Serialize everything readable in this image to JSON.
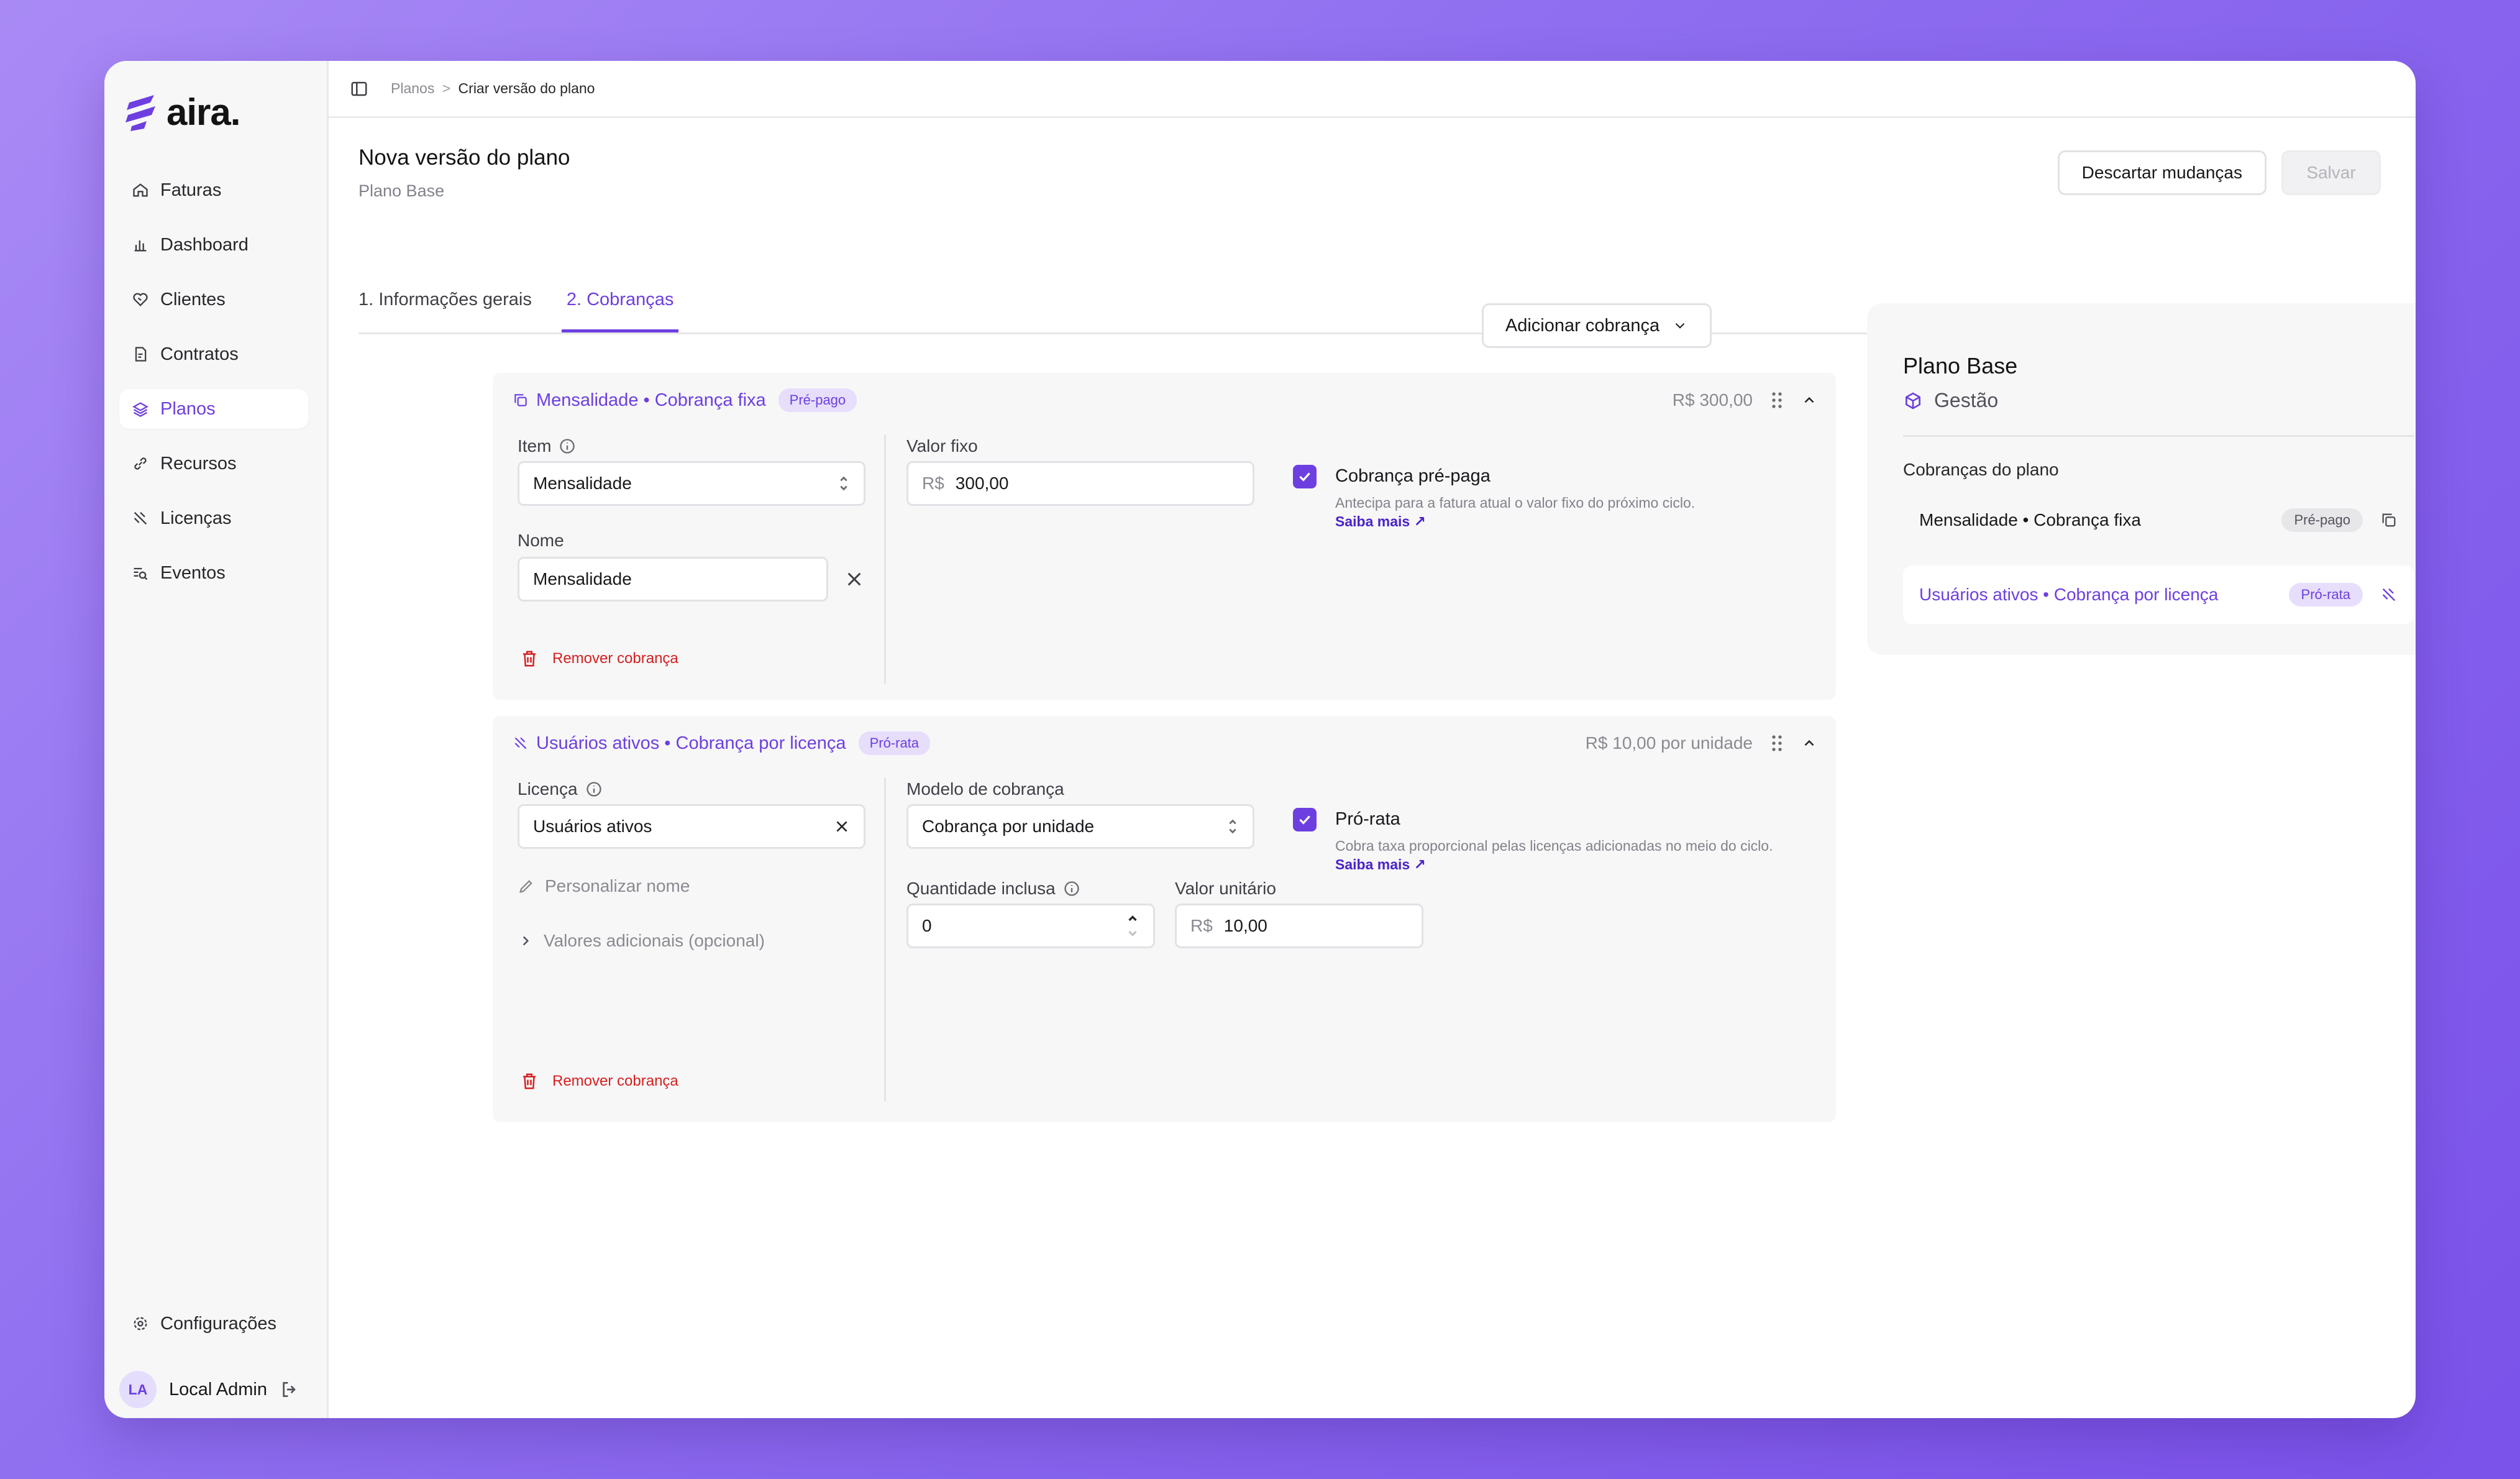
{
  "brand": {
    "name": "aira."
  },
  "sidebar": {
    "items": [
      {
        "label": "Faturas",
        "icon": "home-icon"
      },
      {
        "label": "Dashboard",
        "icon": "bar-chart-icon"
      },
      {
        "label": "Clientes",
        "icon": "handshake-icon"
      },
      {
        "label": "Contratos",
        "icon": "contract-icon"
      },
      {
        "label": "Planos",
        "icon": "layers-icon",
        "active": true
      },
      {
        "label": "Recursos",
        "icon": "link-icon"
      },
      {
        "label": "Licenças",
        "icon": "license-icon"
      },
      {
        "label": "Eventos",
        "icon": "search-list-icon"
      }
    ],
    "settings_label": "Configurações",
    "user": {
      "initials": "LA",
      "name": "Local Admin"
    }
  },
  "breadcrumb": {
    "parent": "Planos",
    "separator": ">",
    "current": "Criar versão do plano"
  },
  "page": {
    "title": "Nova versão do plano",
    "subtitle": "Plano Base",
    "discard_label": "Descartar mudanças",
    "save_label": "Salvar"
  },
  "tabs": [
    {
      "label": "1. Informações gerais"
    },
    {
      "label": "2. Cobranças",
      "active": true
    }
  ],
  "add_charge_label": "Adicionar cobrança",
  "charges": [
    {
      "title": "Mensalidade • Cobrança fixa",
      "badge": "Pré-pago",
      "amount": "R$ 300,00",
      "item_label": "Item",
      "item_value": "Mensalidade",
      "name_label": "Nome",
      "name_value": "Mensalidade",
      "fixed_label": "Valor fixo",
      "currency_prefix": "R$",
      "fixed_value": "300,00",
      "checkbox_label": "Cobrança pré-paga",
      "checkbox_desc": "Antecipa para a fatura atual o valor fixo do próximo ciclo.",
      "learn_more": "Saiba mais",
      "remove_label": "Remover cobrança"
    },
    {
      "title": "Usuários ativos • Cobrança por licença",
      "badge": "Pró-rata",
      "amount": "R$ 10,00 por unidade",
      "license_label": "Licença",
      "license_value": "Usuários ativos",
      "customize_name": "Personalizar nome",
      "additional_values": "Valores adicionais (opcional)",
      "model_label": "Modelo de cobrança",
      "model_value": "Cobrança por unidade",
      "qty_label": "Quantidade inclusa",
      "qty_value": "0",
      "unit_label": "Valor unitário",
      "currency_prefix": "R$",
      "unit_value": "10,00",
      "checkbox_label": "Pró-rata",
      "checkbox_desc": "Cobra taxa proporcional pelas licenças adicionadas no meio do ciclo.",
      "learn_more": "Saiba mais",
      "remove_label": "Remover cobrança"
    }
  ],
  "summary": {
    "title": "Plano Base",
    "product": "Gestão",
    "section_label": "Cobranças do plano",
    "rows": [
      {
        "label": "Mensalidade • Cobrança fixa",
        "badge": "Pré-pago"
      },
      {
        "label": "Usuários ativos • Cobrança por licença",
        "badge": "Pró-rata",
        "selected": true
      }
    ]
  },
  "colors": {
    "accent": "#6d3fe0",
    "danger": "#d61f1f",
    "background": "#8f6ef0"
  }
}
